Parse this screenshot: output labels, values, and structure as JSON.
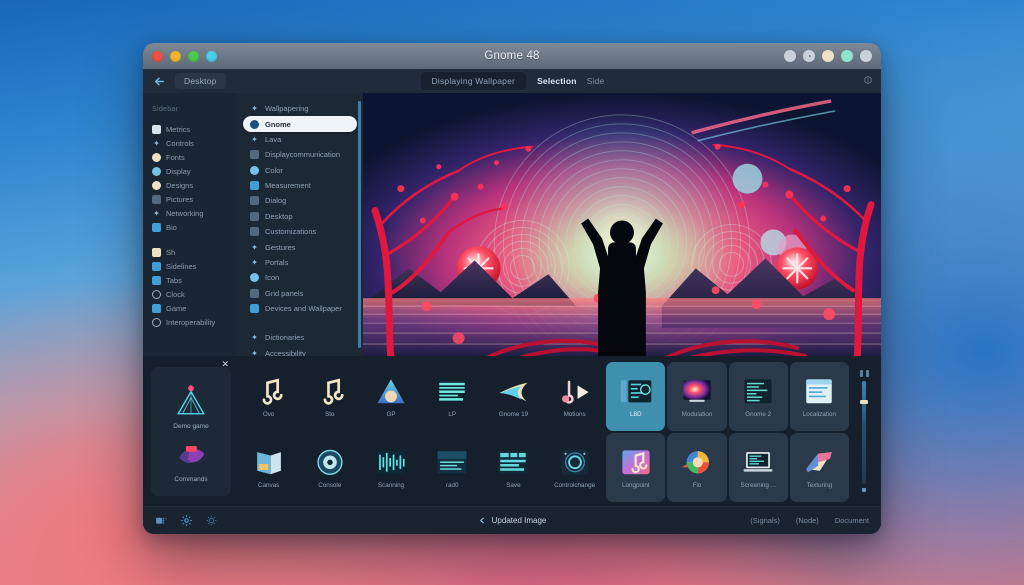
{
  "window": {
    "title": "Gnome 48",
    "traffic_lights": [
      "close",
      "minimize",
      "maximize",
      "fullscreen"
    ],
    "right_buttons": [
      "circle-button",
      "clock-icon-button",
      "cream-button",
      "mint-button",
      "plain-button"
    ]
  },
  "toolbar": {
    "back_icon": "back-arrow-icon",
    "left_chip": "Desktop",
    "tab_pill": "Displaying Wallpaper",
    "tab_active": "Selection",
    "tab_dim": "Side",
    "right_icon": "menu-icon"
  },
  "sidebar": {
    "header": "Sidebar",
    "groups": [
      {
        "items": [
          {
            "label": "Metrics",
            "icon": "cloud-icon",
            "icon_class": "ic wht sq"
          },
          {
            "label": "Controls",
            "icon": "pencil-icon",
            "icon_class": "ic glyph"
          },
          {
            "label": "Fonts",
            "icon": "circle-icon",
            "icon_class": "ic cream circle"
          },
          {
            "label": "Display",
            "icon": "droplet-icon",
            "icon_class": "ic lblue circle"
          },
          {
            "label": "Designs",
            "icon": "circle-icon",
            "icon_class": "ic cream circle"
          },
          {
            "label": "Pictures",
            "icon": "picture-icon",
            "icon_class": "ic slate sq"
          },
          {
            "label": "Networking",
            "icon": "wifi-icon",
            "icon_class": "ic glyph"
          },
          {
            "label": "Bio",
            "icon": "camera-icon",
            "icon_class": "ic blue sq"
          }
        ]
      },
      {
        "items": [
          {
            "label": "Sh",
            "icon": "cloud-icon",
            "icon_class": "ic cream sq"
          },
          {
            "label": "Sidelines",
            "icon": "square-icon",
            "icon_class": "ic blue sq"
          },
          {
            "label": "Tabs",
            "icon": "square-icon",
            "icon_class": "ic blue sq"
          },
          {
            "label": "Clock",
            "icon": "clock-icon",
            "icon_class": "ic ring"
          },
          {
            "label": "Game",
            "icon": "square-icon",
            "icon_class": "ic blue sq"
          },
          {
            "label": "Interoperability",
            "icon": "circle-outline-icon",
            "icon_class": "ic ring"
          }
        ]
      }
    ]
  },
  "list_panel": {
    "groups": [
      {
        "items": [
          {
            "label": "Wallpapering",
            "icon": "gear-icon",
            "icon_class": "ic glyph",
            "selected": false
          },
          {
            "label": "Gnome",
            "icon": "gnome-icon",
            "icon_class": "ic blue circle",
            "selected": true
          },
          {
            "label": "Lava",
            "icon": "power-icon",
            "icon_class": "ic glyph",
            "selected": false
          },
          {
            "label": "Displaycommunication",
            "icon": "trash-icon",
            "icon_class": "ic slate sq",
            "selected": false
          },
          {
            "label": "Color",
            "icon": "color-icon",
            "icon_class": "ic lblue circle",
            "selected": false
          },
          {
            "label": "Measurement",
            "icon": "document-icon",
            "icon_class": "ic blue sq",
            "selected": false
          },
          {
            "label": "Dialog",
            "icon": "window-icon",
            "icon_class": "ic slate sq",
            "selected": false
          },
          {
            "label": "Desktop",
            "icon": "window-icon",
            "icon_class": "ic slate sq",
            "selected": false
          },
          {
            "label": "Customizations",
            "icon": "list-icon",
            "icon_class": "ic slate sq",
            "selected": false
          },
          {
            "label": "Gestures",
            "icon": "hand-icon",
            "icon_class": "ic glyph",
            "selected": false
          },
          {
            "label": "Portals",
            "icon": "portal-icon",
            "icon_class": "ic glyph",
            "selected": false
          },
          {
            "label": "Icon",
            "icon": "cloud-icon",
            "icon_class": "ic lblue circle",
            "selected": false
          },
          {
            "label": "Grid panels",
            "icon": "grid-icon",
            "icon_class": "ic slate sq",
            "selected": false
          },
          {
            "label": "Devices and Wallpaper",
            "icon": "monitor-icon",
            "icon_class": "ic blue sq",
            "selected": false
          }
        ]
      },
      {
        "items": [
          {
            "label": "Dictionaries",
            "icon": "dots-icon",
            "icon_class": "ic glyph",
            "selected": false
          },
          {
            "label": "Accessibility",
            "icon": "accessibility-icon",
            "icon_class": "ic glyph",
            "selected": false
          }
        ]
      }
    ]
  },
  "preview": {
    "alt": "Wallpaper preview: silhouetted figure with raised arms before glowing concentric sunrise over water, framed by red blossom trees"
  },
  "popover": {
    "close_icon": "close-icon",
    "tiles": [
      {
        "label": "Demo game",
        "icon": "triangle-beacon-icon"
      },
      {
        "label": "Commands",
        "icon": "ribbon-icon"
      }
    ]
  },
  "app_grid": {
    "tiles": [
      {
        "label": "Ovo",
        "icon": "music-note-icon",
        "state": "normal"
      },
      {
        "label": "Sto",
        "icon": "music-note-icon",
        "state": "normal"
      },
      {
        "label": "GP",
        "icon": "triangle-photo-icon",
        "state": "normal"
      },
      {
        "label": "LP",
        "icon": "spectrum-icon",
        "state": "normal"
      },
      {
        "label": "Gnome 19",
        "icon": "swoosh-icon",
        "state": "normal"
      },
      {
        "label": "Motions",
        "icon": "note-play-icon",
        "state": "normal"
      },
      {
        "label": "L8D",
        "icon": "terminal-window-icon",
        "state": "selected"
      },
      {
        "label": "Modulation",
        "icon": "nebula-screen-icon",
        "state": "highlight"
      },
      {
        "label": "Gnome 2",
        "icon": "code-editor-icon",
        "state": "highlight"
      },
      {
        "label": "Localization",
        "icon": "document-window-icon",
        "state": "highlight"
      },
      {
        "label": "Canvas",
        "icon": "book-icon",
        "state": "normal"
      },
      {
        "label": "Console",
        "icon": "disc-icon",
        "state": "normal"
      },
      {
        "label": "Scanning",
        "icon": "waveform-icon",
        "state": "normal"
      },
      {
        "label": "rad0",
        "icon": "text-window-icon",
        "state": "normal"
      },
      {
        "label": "Save",
        "icon": "table-icon",
        "state": "normal"
      },
      {
        "label": "Controlchange",
        "icon": "knob-icon",
        "state": "normal"
      },
      {
        "label": "Longpoint",
        "icon": "photos-icon",
        "state": "highlight"
      },
      {
        "label": "Flo",
        "icon": "color-wheel-icon",
        "state": "highlight"
      },
      {
        "label": "Screening ...",
        "icon": "laptop-icon",
        "state": "highlight"
      },
      {
        "label": "Texturing",
        "icon": "open-book-icon",
        "state": "highlight"
      }
    ],
    "slider": {
      "caps": 2,
      "knob_position": "18%"
    }
  },
  "statusbar": {
    "icons": [
      "image-stack-icon",
      "gear-icon",
      "settings-icon"
    ],
    "center_icon": "back-arrow-icon",
    "center_label": "Updated Image",
    "right_links": [
      "(Signals)",
      "(Node)",
      "Document"
    ]
  },
  "colors": {
    "accent": "#3f8fae",
    "window_bg": "#16202c",
    "sidebar_bg": "#1b2634",
    "list_bg": "#1d2835",
    "selection": "#eef4f9"
  }
}
